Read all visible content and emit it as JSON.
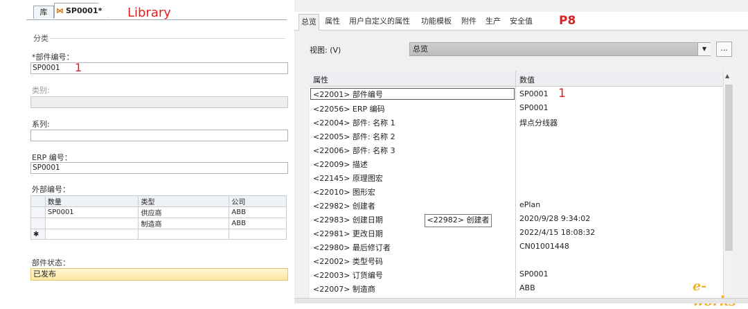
{
  "left": {
    "tab_lib": "库",
    "tab_doc": "SP0001*",
    "annotation": "Library",
    "section_category": "分类",
    "part_number_label": "*部件编号：",
    "part_number_value": "SP0001",
    "part_number_note": "1",
    "type_label": "类别:",
    "series_label": "系列:",
    "erp_label": "ERP 编号：",
    "erp_value": "SP0001",
    "external_label": "外部编号：",
    "table_headers": [
      "数量",
      "类型",
      "公司"
    ],
    "table_rows": [
      [
        "SP0001",
        "供应商",
        "ABB"
      ],
      [
        "",
        "制造商",
        "ABB"
      ]
    ],
    "new_row_marker": "✱",
    "status_label": "部件状态：",
    "status_value": "已发布"
  },
  "right": {
    "tabs": [
      "总览",
      "属性",
      "用户自定义的属性",
      "功能模板",
      "附件",
      "生产",
      "安全值"
    ],
    "annotation": "P8",
    "view_label": "视图: (V)",
    "view_value": "总览",
    "view_more": "...",
    "col_property": "属性",
    "col_value": "数值",
    "value_note": "1",
    "rows": [
      {
        "p": "<22001> 部件编号",
        "v": "SP0001"
      },
      {
        "p": "<22056> ERP 编码",
        "v": "SP0001"
      },
      {
        "p": "<22004> 部件: 名称 1",
        "v": "焊点分线器"
      },
      {
        "p": "<22005> 部件: 名称 2",
        "v": ""
      },
      {
        "p": "<22006> 部件: 名称 3",
        "v": ""
      },
      {
        "p": "<22009> 描述",
        "v": ""
      },
      {
        "p": "<22145> 原理图宏",
        "v": ""
      },
      {
        "p": "<22010> 图形宏",
        "v": ""
      },
      {
        "p": "<22982> 创建者",
        "v": "ePlan"
      },
      {
        "p": "<22983> 创建日期",
        "v": "2020/9/28 9:34:02"
      },
      {
        "p": "<22981> 更改日期",
        "v": "2022/4/15 18:08:32"
      },
      {
        "p": "<22980> 最后修订者",
        "v": "CN01001448"
      },
      {
        "p": "<22002> 类型号码",
        "v": ""
      },
      {
        "p": "<22003> 订货编号",
        "v": "SP0001"
      },
      {
        "p": "<22007> 制造商",
        "v": "ABB"
      }
    ],
    "tooltip": "<22982> 创建者",
    "logo": "e-works"
  }
}
